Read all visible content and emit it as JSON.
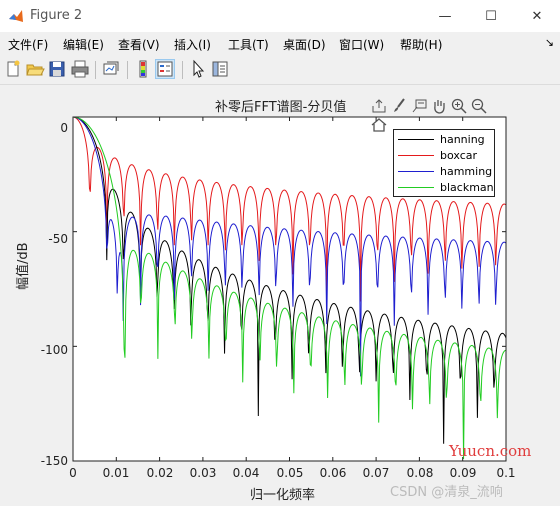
{
  "window": {
    "title": "Figure 2",
    "controls": {
      "minimize": "—",
      "maximize": "☐",
      "close": "✕"
    }
  },
  "menu": [
    "文件(F)",
    "编辑(E)",
    "查看(V)",
    "插入(I)",
    "工具(T)",
    "桌面(D)",
    "窗口(W)",
    "帮助(H)"
  ],
  "toolbar_icons": [
    "new-figure-icon",
    "open-file-icon",
    "save-icon",
    "print-icon",
    "link-plot-icon",
    "colorbar-icon",
    "legend-icon",
    "pointer-icon",
    "property-inspector-icon"
  ],
  "axes_toolbar_icons": [
    "export-icon",
    "brush-icon",
    "datatip-icon",
    "pan-icon",
    "zoom-in-icon",
    "zoom-out-icon",
    "home-icon"
  ],
  "chart_data": {
    "type": "line",
    "title": "补零后FFT谱图-分贝值",
    "xlabel": "归一化频率",
    "ylabel": "幅值/dB",
    "xlim": [
      0,
      0.1
    ],
    "ylim": [
      -150,
      0
    ],
    "xticks": [
      "0",
      "0.01",
      "0.02",
      "0.03",
      "0.04",
      "0.05",
      "0.06",
      "0.07",
      "0.08",
      "0.09",
      "0.1"
    ],
    "yticks": [
      "0",
      "-50",
      "-100",
      "-150"
    ],
    "grid": false,
    "legend_position": "top-right",
    "series": [
      {
        "name": "hanning",
        "color": "#000000",
        "window": "hanning"
      },
      {
        "name": "boxcar",
        "color": "#e41a1c",
        "window": "boxcar"
      },
      {
        "name": "hamming",
        "color": "#1f1fcf",
        "window": "hamming"
      },
      {
        "name": "blackman",
        "color": "#22cc22",
        "window": "blackman"
      }
    ]
  },
  "watermarks": {
    "site": "Yuucn.com",
    "csdn": "CSDN @清泉_流响"
  }
}
